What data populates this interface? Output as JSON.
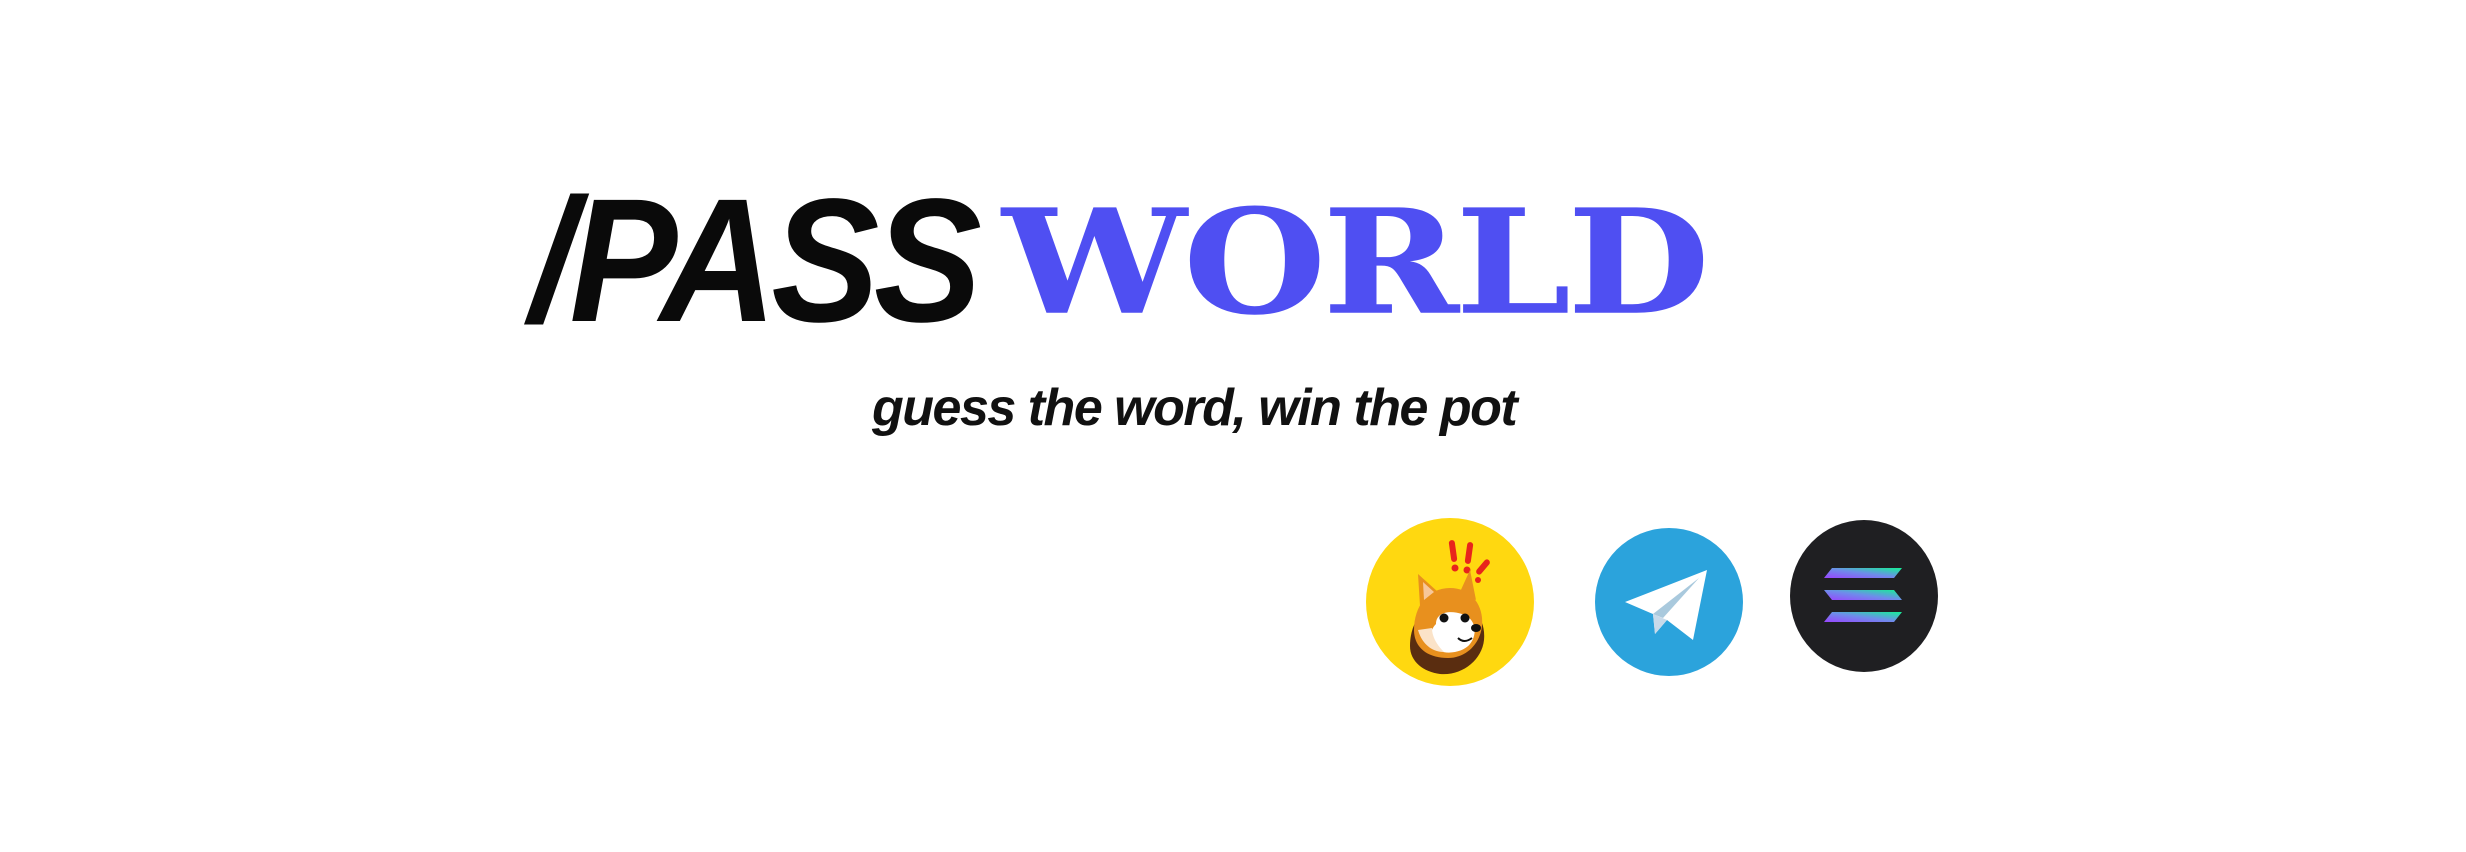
{
  "logo": {
    "part1": "/PASS",
    "part2": "WORLD",
    "part2_color": "#4f4ff2"
  },
  "tagline": "guess the word, win the pot",
  "links": [
    {
      "icon": "doge-mascot-icon",
      "color": "#ffd810"
    },
    {
      "icon": "telegram-icon",
      "color": "#2ba3dc"
    },
    {
      "icon": "solana-icon",
      "color": "#1f1f22"
    }
  ]
}
